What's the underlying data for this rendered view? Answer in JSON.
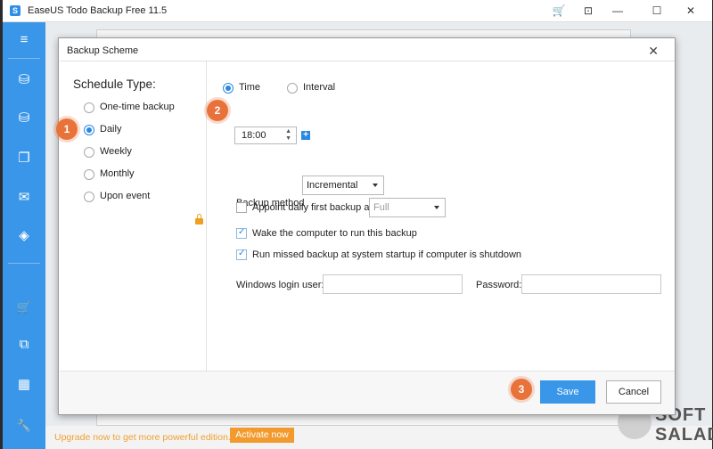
{
  "app": {
    "title": "EaseUS Todo Backup Free 11.5",
    "logo_glyph": "S",
    "window_controls": {
      "cart": "🛒",
      "collapse": "⊡",
      "minimize": "—",
      "maximize": "☐",
      "close": "✕"
    }
  },
  "sidebar": {
    "items": [
      {
        "icon": "menu-icon",
        "glyph": "≡"
      },
      {
        "icon": "disk-backup-icon",
        "glyph": "⛁"
      },
      {
        "icon": "system-backup-icon",
        "glyph": "⛁"
      },
      {
        "icon": "file-backup-icon",
        "glyph": "❐"
      },
      {
        "icon": "mail-backup-icon",
        "glyph": "✉"
      },
      {
        "icon": "smart-backup-icon",
        "glyph": "◈"
      },
      {
        "icon": "cart-icon",
        "glyph": "🛒"
      },
      {
        "icon": "clone-icon",
        "glyph": "⧉"
      },
      {
        "icon": "apps-icon",
        "glyph": "▦"
      },
      {
        "icon": "tools-icon",
        "glyph": "🔧"
      }
    ]
  },
  "upgrade_bar": {
    "text": "Upgrade now to get more powerful edition.",
    "button": "Activate now"
  },
  "watermark": {
    "line1": "SOFT",
    "line2": "SALAD"
  },
  "dialog": {
    "title": "Backup Scheme",
    "close": "✕",
    "schedule_type_label": "Schedule Type:",
    "schedule_options": [
      "One-time backup",
      "Daily",
      "Weekly",
      "Monthly",
      "Upon event"
    ],
    "selected_option": "Daily",
    "trigger": {
      "time_label": "Time",
      "interval_label": "Interval",
      "selected": "Time"
    },
    "time_value": "18:00",
    "time_spin_arrows": "▲\n▼",
    "add_time": "+",
    "backup_method_label": "Backup method",
    "backup_method_value": "Incremental",
    "appoint_label": "Appoint daily first backup as",
    "appoint_value": "Full",
    "appoint_checked": false,
    "wake_label": "Wake the computer to run this backup",
    "wake_checked": true,
    "run_missed_label": "Run missed backup at system startup if computer is shutdown",
    "run_missed_checked": true,
    "login_user_label": "Windows login user:",
    "login_user_value": "",
    "password_label": "Password:",
    "password_value": "",
    "save_button": "Save",
    "cancel_button": "Cancel"
  },
  "badges": [
    "1",
    "2",
    "3"
  ],
  "colors": {
    "accent": "#3a96e8",
    "badge": "#e9723b",
    "upgrade": "#f29a2e"
  }
}
